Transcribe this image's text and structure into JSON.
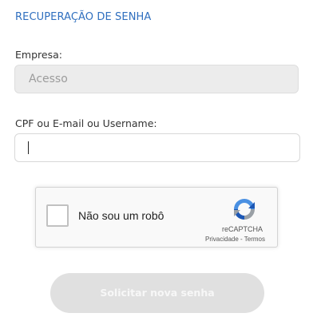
{
  "page": {
    "title": "RECUPERAÇÃO DE SENHA"
  },
  "form": {
    "empresa": {
      "label": "Empresa:",
      "value": "Acesso"
    },
    "identifier": {
      "label": "CPF ou E-mail ou Username:",
      "value": ""
    }
  },
  "recaptcha": {
    "label": "Não sou um robô",
    "brand": "reCAPTCHA",
    "privacy_link": "Privacidade",
    "separator": " - ",
    "terms_link": "Termos",
    "logo_icon": "recaptcha-logo-icon"
  },
  "actions": {
    "submit_label": "Solicitar nova senha"
  },
  "colors": {
    "accent": "#2f6fbf",
    "disabled_button": "#e0e0e0",
    "field_disabled": "#ececec"
  }
}
